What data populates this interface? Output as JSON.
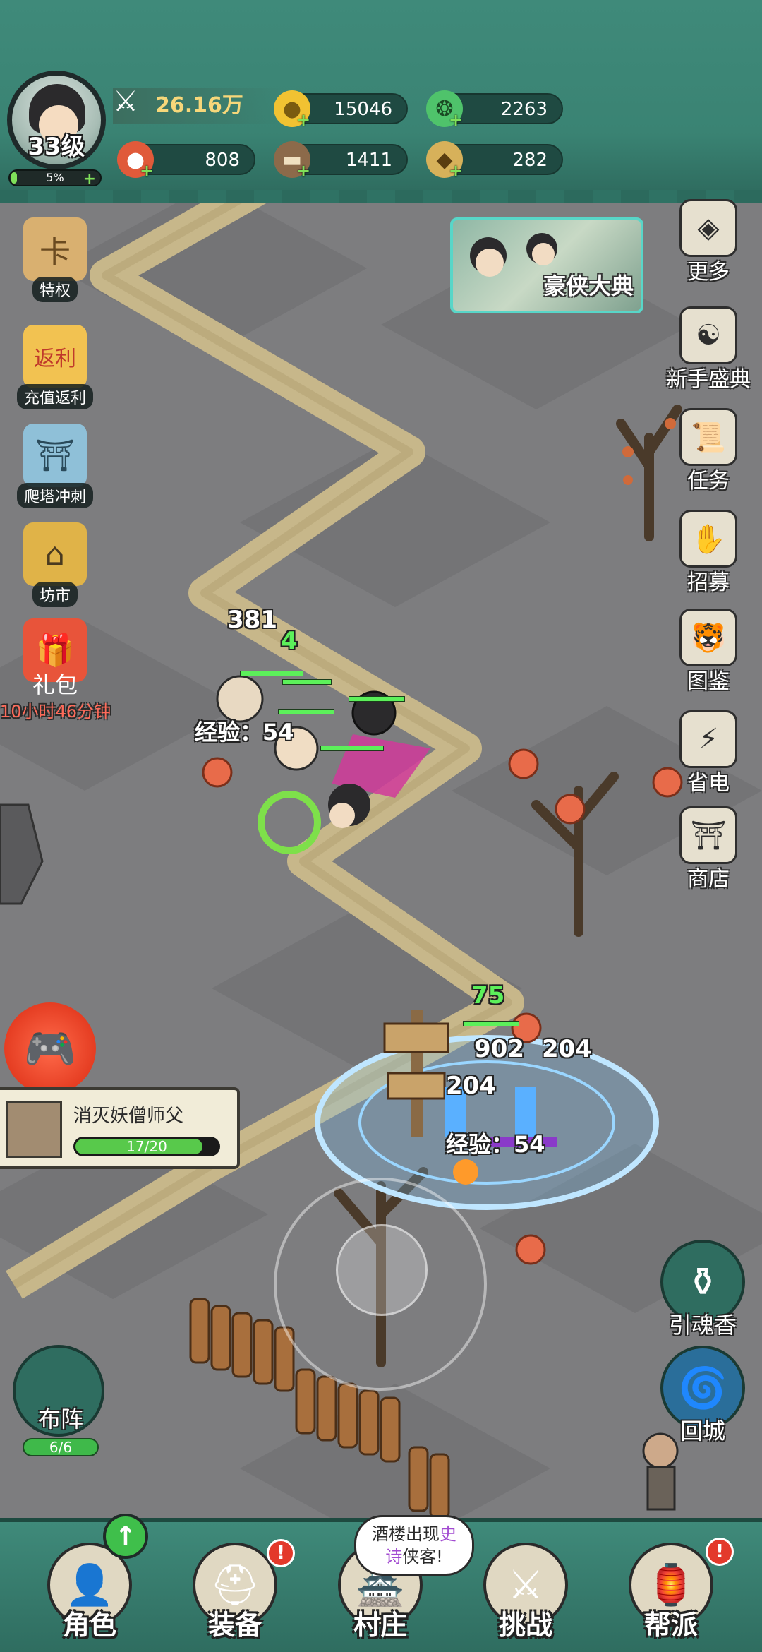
{
  "header": {
    "level": "33级",
    "exp_percent": "5%",
    "power": "26.16万",
    "resources": [
      {
        "name": "gold",
        "value": "15046",
        "color": "#f1c232"
      },
      {
        "name": "jade",
        "value": "2263",
        "color": "#4fc36b"
      },
      {
        "name": "meat",
        "value": "808",
        "color": "#e05a3a"
      },
      {
        "name": "wood",
        "value": "1411",
        "color": "#8c6a4a"
      },
      {
        "name": "ore",
        "value": "282",
        "color": "#d7b15a"
      }
    ]
  },
  "left_icons": [
    {
      "label": "特权",
      "icon": "card-icon"
    },
    {
      "label": "充值返利",
      "icon": "rebate-icon"
    },
    {
      "label": "爬塔冲刺",
      "icon": "tower-icon"
    },
    {
      "label": "坊市",
      "icon": "market-icon"
    },
    {
      "label": "礼包",
      "icon": "gift-icon"
    }
  ],
  "gift_timer": "10小时46分钟",
  "banner": {
    "title": "豪侠大典"
  },
  "right_icons": [
    {
      "label": "更多",
      "icon": "more-icon"
    },
    {
      "label": "新手盛典",
      "icon": "newbie-icon"
    },
    {
      "label": "任务",
      "icon": "scroll-icon"
    },
    {
      "label": "招募",
      "icon": "recruit-icon"
    },
    {
      "label": "图鉴",
      "icon": "codex-icon"
    },
    {
      "label": "省电",
      "icon": "battery-icon"
    },
    {
      "label": "商店",
      "icon": "shop-icon"
    }
  ],
  "battle": {
    "numbers": [
      "381",
      "4",
      "经验：54",
      "75",
      "902",
      "204",
      "204",
      "经验：54"
    ]
  },
  "quest": {
    "name": "消灭妖僧师父",
    "progress": "17/20",
    "progress_fraction": 0.85
  },
  "round_buttons": [
    {
      "label": "引魂香",
      "icon": "incense-icon"
    },
    {
      "label": "回城",
      "icon": "portal-icon"
    }
  ],
  "formation": {
    "label": "布阵",
    "count": "6/6"
  },
  "bottom_nav": [
    {
      "label": "角色",
      "icon": "hero-icon"
    },
    {
      "label": "装备",
      "icon": "helmet-icon"
    },
    {
      "label": "村庄",
      "icon": "village-icon"
    },
    {
      "label": "挑战",
      "icon": "sword-icon"
    },
    {
      "label": "帮派",
      "icon": "banner-icon"
    }
  ],
  "speech": {
    "line1": "酒楼出现",
    "epic": "史",
    "line2_epic": "诗",
    "line2": "侠客!"
  },
  "colors": {
    "accent": "#3f8a7a",
    "bg": "#7d7d7f",
    "path": "#c7b78a"
  }
}
